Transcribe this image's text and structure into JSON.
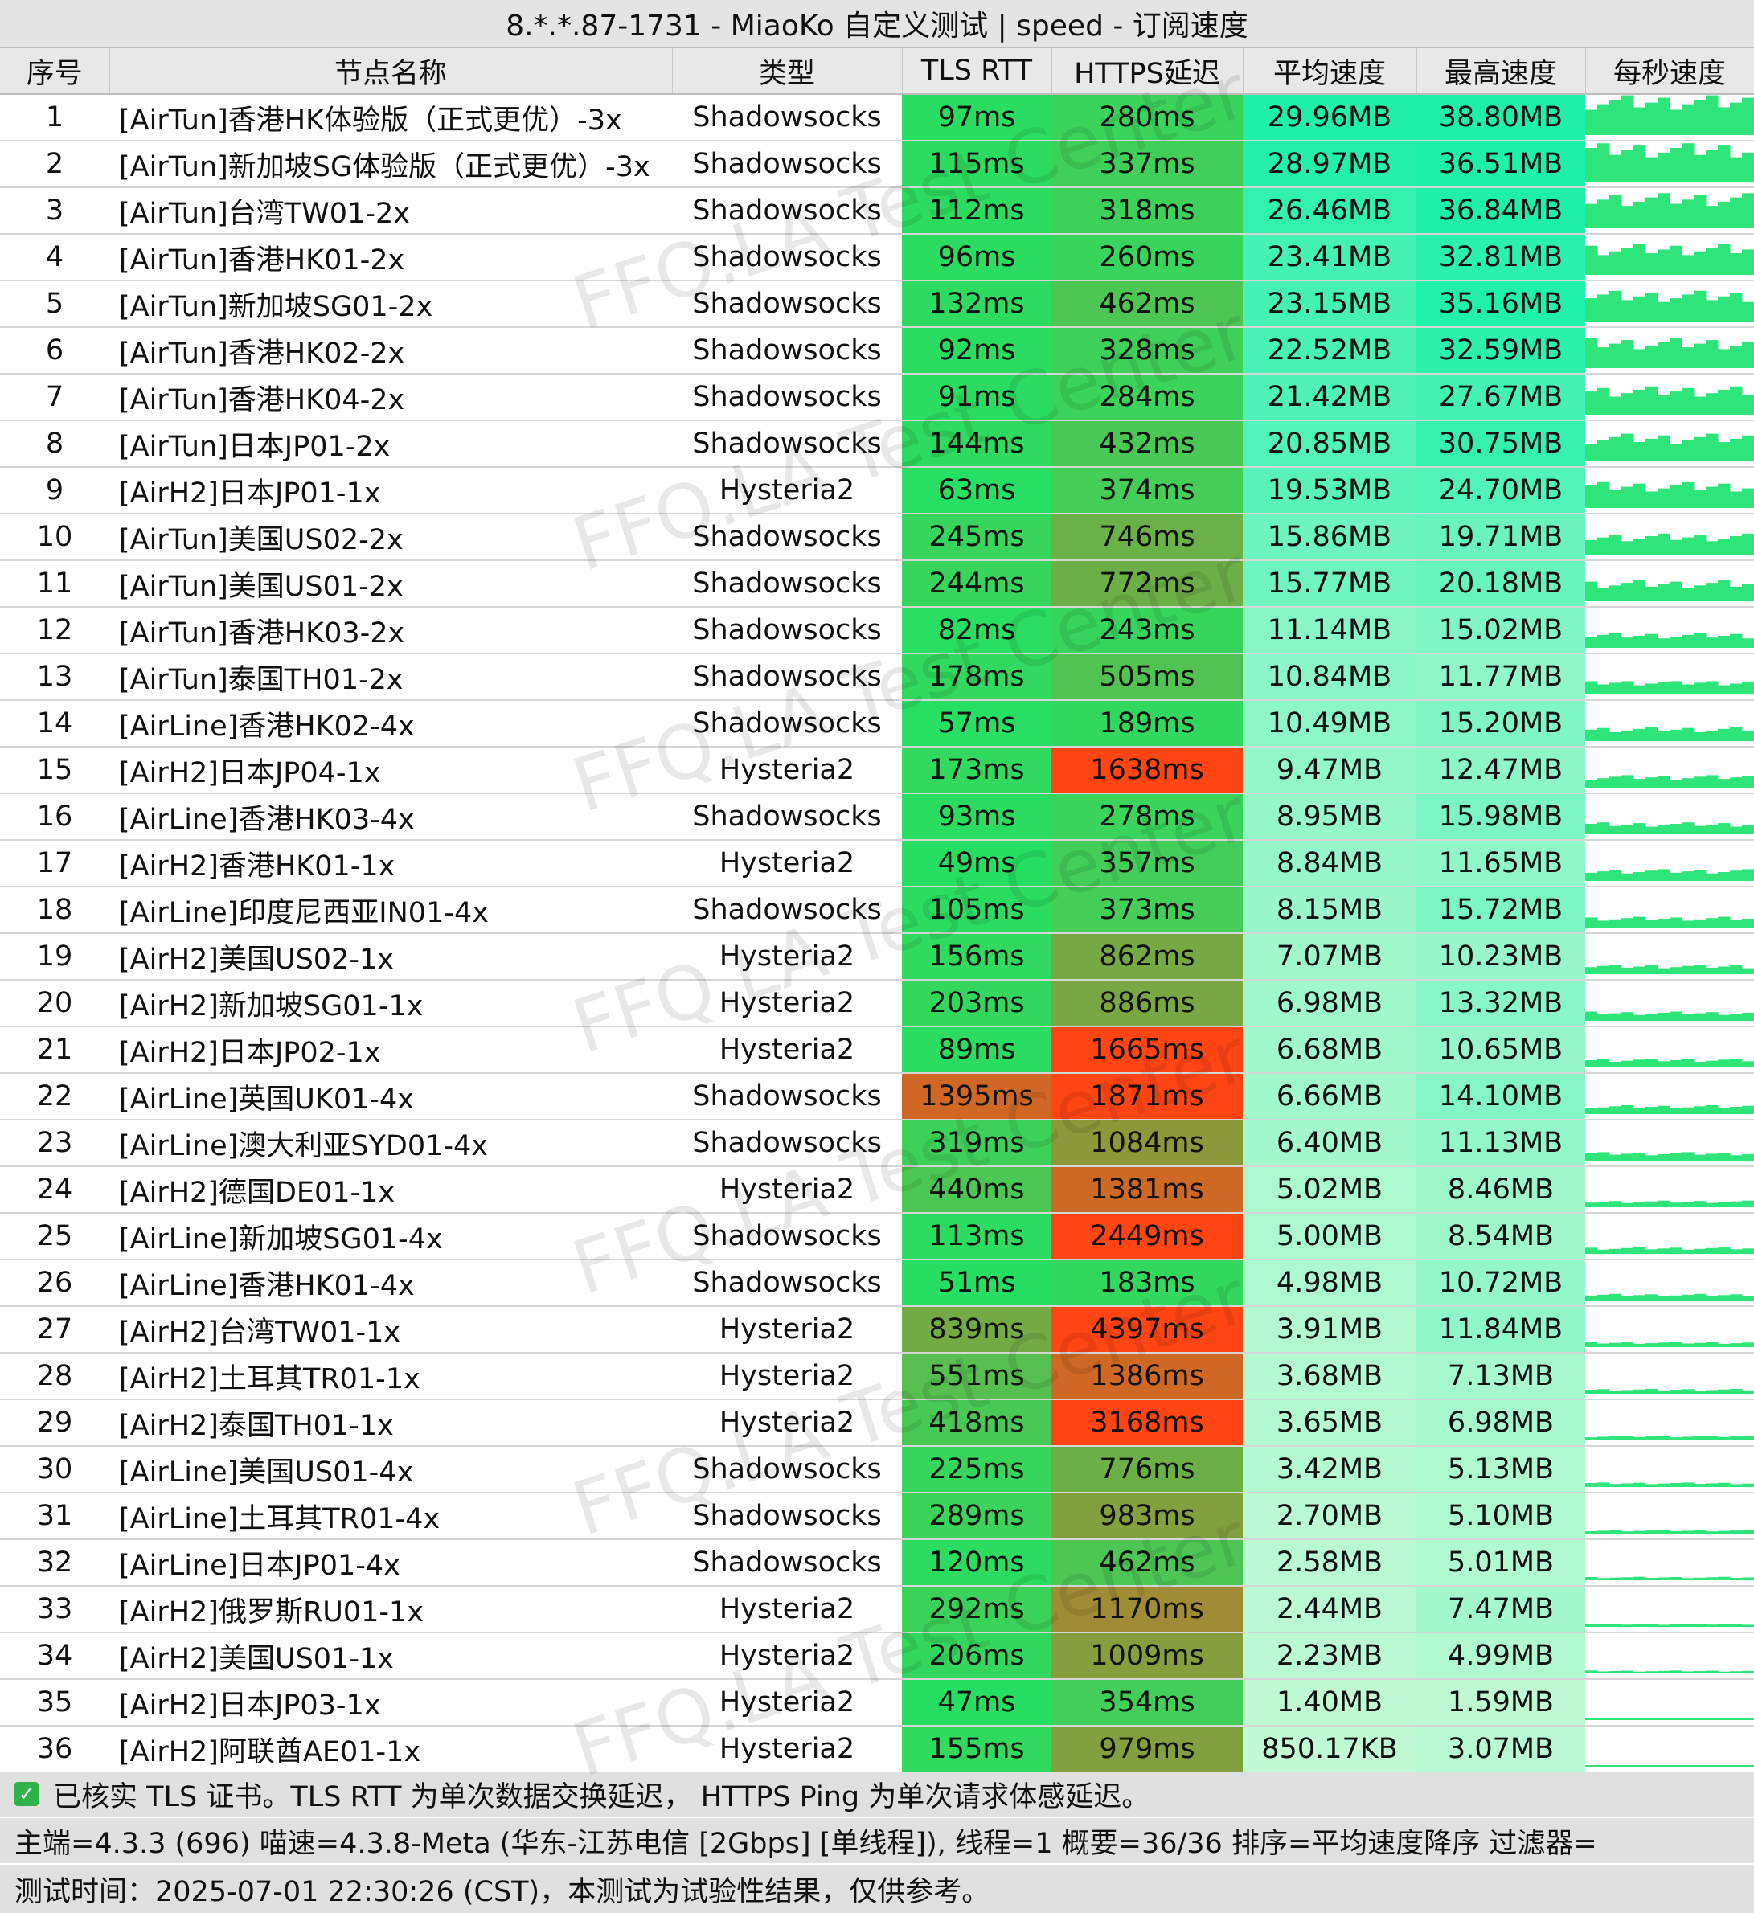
{
  "title": "8.*.*.87-1731 - MiaoKo 自定义测试 | speed - 订阅速度",
  "headers": [
    "序号",
    "节点名称",
    "类型",
    "TLS RTT",
    "HTTPS延迟",
    "平均速度",
    "最高速度",
    "每秒速度"
  ],
  "watermark": "FFQ.LA Test Center",
  "rows": [
    {
      "id": "1",
      "name": "[AirTun]香港HK体验版（正式更优）-3x",
      "type": "Shadowsocks",
      "tls": "97ms",
      "https": "280ms",
      "avg": "29.96MB",
      "max": "38.80MB"
    },
    {
      "id": "2",
      "name": "[AirTun]新加坡SG体验版（正式更优）-3x",
      "type": "Shadowsocks",
      "tls": "115ms",
      "https": "337ms",
      "avg": "28.97MB",
      "max": "36.51MB"
    },
    {
      "id": "3",
      "name": "[AirTun]台湾TW01-2x",
      "type": "Shadowsocks",
      "tls": "112ms",
      "https": "318ms",
      "avg": "26.46MB",
      "max": "36.84MB"
    },
    {
      "id": "4",
      "name": "[AirTun]香港HK01-2x",
      "type": "Shadowsocks",
      "tls": "96ms",
      "https": "260ms",
      "avg": "23.41MB",
      "max": "32.81MB"
    },
    {
      "id": "5",
      "name": "[AirTun]新加坡SG01-2x",
      "type": "Shadowsocks",
      "tls": "132ms",
      "https": "462ms",
      "avg": "23.15MB",
      "max": "35.16MB"
    },
    {
      "id": "6",
      "name": "[AirTun]香港HK02-2x",
      "type": "Shadowsocks",
      "tls": "92ms",
      "https": "328ms",
      "avg": "22.52MB",
      "max": "32.59MB"
    },
    {
      "id": "7",
      "name": "[AirTun]香港HK04-2x",
      "type": "Shadowsocks",
      "tls": "91ms",
      "https": "284ms",
      "avg": "21.42MB",
      "max": "27.67MB"
    },
    {
      "id": "8",
      "name": "[AirTun]日本JP01-2x",
      "type": "Shadowsocks",
      "tls": "144ms",
      "https": "432ms",
      "avg": "20.85MB",
      "max": "30.75MB"
    },
    {
      "id": "9",
      "name": "[AirH2]日本JP01-1x",
      "type": "Hysteria2",
      "tls": "63ms",
      "https": "374ms",
      "avg": "19.53MB",
      "max": "24.70MB"
    },
    {
      "id": "10",
      "name": "[AirTun]美国US02-2x",
      "type": "Shadowsocks",
      "tls": "245ms",
      "https": "746ms",
      "avg": "15.86MB",
      "max": "19.71MB"
    },
    {
      "id": "11",
      "name": "[AirTun]美国US01-2x",
      "type": "Shadowsocks",
      "tls": "244ms",
      "https": "772ms",
      "avg": "15.77MB",
      "max": "20.18MB"
    },
    {
      "id": "12",
      "name": "[AirTun]香港HK03-2x",
      "type": "Shadowsocks",
      "tls": "82ms",
      "https": "243ms",
      "avg": "11.14MB",
      "max": "15.02MB"
    },
    {
      "id": "13",
      "name": "[AirTun]泰国TH01-2x",
      "type": "Shadowsocks",
      "tls": "178ms",
      "https": "505ms",
      "avg": "10.84MB",
      "max": "11.77MB"
    },
    {
      "id": "14",
      "name": "[AirLine]香港HK02-4x",
      "type": "Shadowsocks",
      "tls": "57ms",
      "https": "189ms",
      "avg": "10.49MB",
      "max": "15.20MB"
    },
    {
      "id": "15",
      "name": "[AirH2]日本JP04-1x",
      "type": "Hysteria2",
      "tls": "173ms",
      "https": "1638ms",
      "avg": "9.47MB",
      "max": "12.47MB"
    },
    {
      "id": "16",
      "name": "[AirLine]香港HK03-4x",
      "type": "Shadowsocks",
      "tls": "93ms",
      "https": "278ms",
      "avg": "8.95MB",
      "max": "15.98MB"
    },
    {
      "id": "17",
      "name": "[AirH2]香港HK01-1x",
      "type": "Hysteria2",
      "tls": "49ms",
      "https": "357ms",
      "avg": "8.84MB",
      "max": "11.65MB"
    },
    {
      "id": "18",
      "name": "[AirLine]印度尼西亚IN01-4x",
      "type": "Shadowsocks",
      "tls": "105ms",
      "https": "373ms",
      "avg": "8.15MB",
      "max": "15.72MB"
    },
    {
      "id": "19",
      "name": "[AirH2]美国US02-1x",
      "type": "Hysteria2",
      "tls": "156ms",
      "https": "862ms",
      "avg": "7.07MB",
      "max": "10.23MB"
    },
    {
      "id": "20",
      "name": "[AirH2]新加坡SG01-1x",
      "type": "Hysteria2",
      "tls": "203ms",
      "https": "886ms",
      "avg": "6.98MB",
      "max": "13.32MB"
    },
    {
      "id": "21",
      "name": "[AirH2]日本JP02-1x",
      "type": "Hysteria2",
      "tls": "89ms",
      "https": "1665ms",
      "avg": "6.68MB",
      "max": "10.65MB"
    },
    {
      "id": "22",
      "name": "[AirLine]英国UK01-4x",
      "type": "Shadowsocks",
      "tls": "1395ms",
      "https": "1871ms",
      "avg": "6.66MB",
      "max": "14.10MB"
    },
    {
      "id": "23",
      "name": "[AirLine]澳大利亚SYD01-4x",
      "type": "Shadowsocks",
      "tls": "319ms",
      "https": "1084ms",
      "avg": "6.40MB",
      "max": "11.13MB"
    },
    {
      "id": "24",
      "name": "[AirH2]德国DE01-1x",
      "type": "Hysteria2",
      "tls": "440ms",
      "https": "1381ms",
      "avg": "5.02MB",
      "max": "8.46MB"
    },
    {
      "id": "25",
      "name": "[AirLine]新加坡SG01-4x",
      "type": "Shadowsocks",
      "tls": "113ms",
      "https": "2449ms",
      "avg": "5.00MB",
      "max": "8.54MB"
    },
    {
      "id": "26",
      "name": "[AirLine]香港HK01-4x",
      "type": "Shadowsocks",
      "tls": "51ms",
      "https": "183ms",
      "avg": "4.98MB",
      "max": "10.72MB"
    },
    {
      "id": "27",
      "name": "[AirH2]台湾TW01-1x",
      "type": "Hysteria2",
      "tls": "839ms",
      "https": "4397ms",
      "avg": "3.91MB",
      "max": "11.84MB"
    },
    {
      "id": "28",
      "name": "[AirH2]土耳其TR01-1x",
      "type": "Hysteria2",
      "tls": "551ms",
      "https": "1386ms",
      "avg": "3.68MB",
      "max": "7.13MB"
    },
    {
      "id": "29",
      "name": "[AirH2]泰国TH01-1x",
      "type": "Hysteria2",
      "tls": "418ms",
      "https": "3168ms",
      "avg": "3.65MB",
      "max": "6.98MB"
    },
    {
      "id": "30",
      "name": "[AirLine]美国US01-4x",
      "type": "Shadowsocks",
      "tls": "225ms",
      "https": "776ms",
      "avg": "3.42MB",
      "max": "5.13MB"
    },
    {
      "id": "31",
      "name": "[AirLine]土耳其TR01-4x",
      "type": "Shadowsocks",
      "tls": "289ms",
      "https": "983ms",
      "avg": "2.70MB",
      "max": "5.10MB"
    },
    {
      "id": "32",
      "name": "[AirLine]日本JP01-4x",
      "type": "Shadowsocks",
      "tls": "120ms",
      "https": "462ms",
      "avg": "2.58MB",
      "max": "5.01MB"
    },
    {
      "id": "33",
      "name": "[AirH2]俄罗斯RU01-1x",
      "type": "Hysteria2",
      "tls": "292ms",
      "https": "1170ms",
      "avg": "2.44MB",
      "max": "7.47MB"
    },
    {
      "id": "34",
      "name": "[AirH2]美国US01-1x",
      "type": "Hysteria2",
      "tls": "206ms",
      "https": "1009ms",
      "avg": "2.23MB",
      "max": "4.99MB"
    },
    {
      "id": "35",
      "name": "[AirH2]日本JP03-1x",
      "type": "Hysteria2",
      "tls": "47ms",
      "https": "354ms",
      "avg": "1.40MB",
      "max": "1.59MB"
    },
    {
      "id": "36",
      "name": "[AirH2]阿联酋AE01-1x",
      "type": "Hysteria2",
      "tls": "155ms",
      "https": "979ms",
      "avg": "850.17KB",
      "max": "3.07MB"
    }
  ],
  "footer": {
    "line1": "已核实 TLS 证书。TLS RTT 为单次数据交换延迟， HTTPS Ping 为单次请求体感延迟。",
    "line2": "主端=4.3.3 (696) 喵速=4.3.8-Meta (华东-江苏电信 [2Gbps] [单线程]), 线程=1 概要=36/36 排序=平均速度降序 过滤器=",
    "line3": "测试时间：2025-07-01 22:30:26 (CST)，本测试为试验性结果，仅供参考。"
  },
  "colors": {
    "spark": "#2ee57a",
    "checkbox": "#2fb24a"
  }
}
